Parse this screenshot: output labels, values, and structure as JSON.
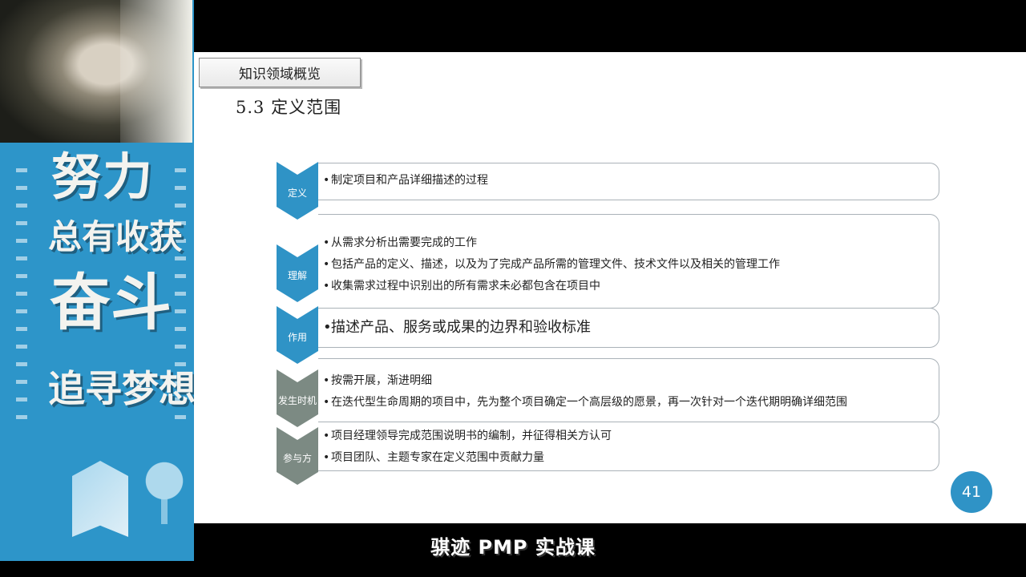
{
  "left_panel": {
    "slogan_lines": [
      "努力",
      "总有收获",
      "奋斗",
      "追寻梦想"
    ]
  },
  "slide": {
    "section_label": "知识领域概览",
    "title": "5.3  定义范围",
    "rows": [
      {
        "label": "定义",
        "style": "blue",
        "bullets": [
          "制定项目和产品详细描述的过程"
        ]
      },
      {
        "label": "理解",
        "style": "blue",
        "bullets": [
          "从需求分析出需要完成的工作",
          "包括产品的定义、描述，以及为了完成产品所需的管理文件、技术文件以及相关的管理工作",
          "收集需求过程中识别出的所有需求未必都包含在项目中"
        ]
      },
      {
        "label": "作用",
        "style": "blue",
        "bullets": [
          "描述产品、服务或成果的边界和验收标准"
        ]
      },
      {
        "label": "发生时机",
        "style": "gray",
        "bullets": [
          "按需开展，渐进明细",
          "在迭代型生命周期的项目中，先为整个项目确定一个高层级的愿景，再一次针对一个迭代期明确详细范围"
        ]
      },
      {
        "label": "参与方",
        "style": "gray",
        "bullets": [
          "项目经理领导完成范围说明书的编制，并征得相关方认可",
          "项目团队、主题专家在定义范围中贡献力量"
        ]
      }
    ],
    "page_number": "41"
  },
  "subtitle": "骐迹 PMP 实战课",
  "colors": {
    "accent_blue": "#2f93c6",
    "chevron_gray": "#7c8a83",
    "panel_blue": "#2d95c9"
  }
}
